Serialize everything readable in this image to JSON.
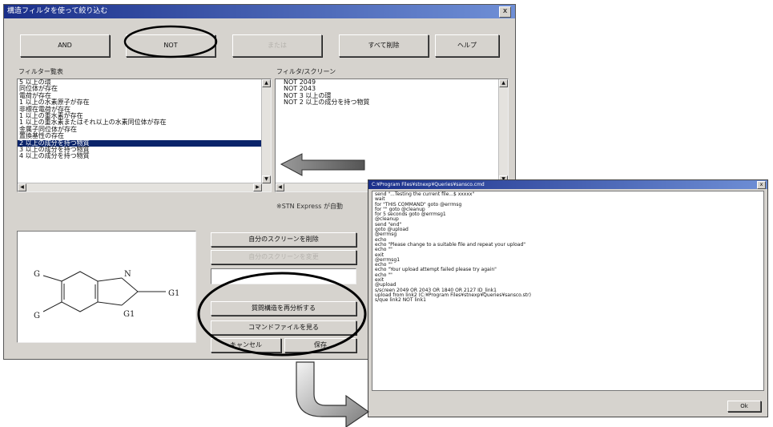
{
  "dialog": {
    "title": "構造フィルタを使って絞り込む",
    "close": "x",
    "buttons": {
      "and": "AND",
      "not": "NOT",
      "or": "または",
      "delete_all": "すべて削除",
      "help": "ヘルプ"
    },
    "filter_list_label": "フィルター覧表",
    "filter_items": [
      "5 以上の環",
      "同位体が存在",
      "電荷が存在",
      "1 以上の水素原子が存在",
      "非標在電荷が存在",
      "1 以上の重水素が存在",
      "1 以上の重水素またはそれ以上の水素同位体が存在",
      "金属子同位体が存在",
      "置換基性の存在",
      "2 以上の成分を持つ物質",
      "3 以上の成分を持つ物質",
      "4 以上の成分を持つ物質"
    ],
    "selected_filter_index": 9,
    "screen_label": "フィルタ/スクリーン",
    "screen_items": [
      "NOT 2049",
      "NOT 2043",
      "NOT 3 以上の環",
      "NOT 2 以上の成分を持つ物質"
    ],
    "auto_note": "※STN Express が自動",
    "side_buttons": {
      "delete_own_screen": "自分のスクリーンを削除",
      "change_own_screen": "自分のスクリーンを変更",
      "reanalyze": "質問構造を再分析する",
      "view_command": "コマンドファイルを見る",
      "cancel": "キャンセル",
      "save": "保存"
    },
    "structure_labels": {
      "g_left_top": "G",
      "g_left_bottom": "G",
      "n": "N",
      "g1_right": "G1",
      "g1_bottom": "G1"
    }
  },
  "console": {
    "title": "C:¥Program Files¥stnexp¥Queries¥sansco.cmd",
    "lines": [
      "send \"...Testing the current file...$ xxxxx\"",
      "wait",
      "  for \"THIS COMMAND\" goto @errmsg",
      "  for \"\" goto @cleanup",
      "  for 5 seconds goto @errmsg1",
      "@cleanup",
      "send \"end\"",
      "goto @upload",
      "@errmsg",
      "echo",
      "echo \"Please change to a suitable file and repeat your upload\"",
      "echo \"\"",
      "exit",
      "@errmsg1",
      "echo \"\"",
      "echo \"Your upload attempt failed please try again\"",
      "echo \"\"",
      "exit",
      "@upload",
      "s/screen 2049 OR 2043 OR 1840 OR 2127 ID_link1",
      "upload from link2 (C:¥Program Files¥stnexp¥Queries¥sansco.str)",
      "s/que link2 NOT link1"
    ],
    "ok": "Ok"
  }
}
